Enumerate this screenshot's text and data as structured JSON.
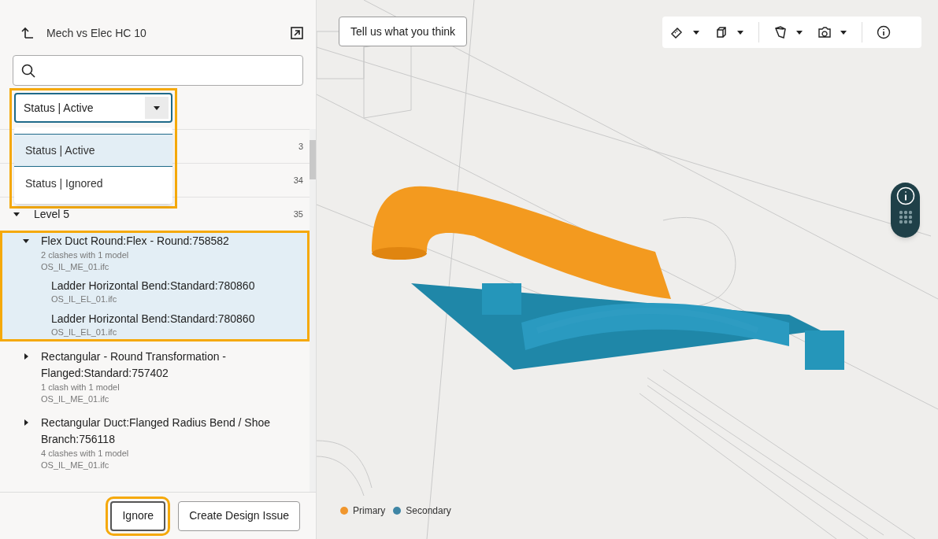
{
  "header": {
    "title": "Mech vs Elec HC 10"
  },
  "filter": {
    "value": "Status | Active",
    "expanded": true,
    "options": [
      {
        "label": "Status | Active",
        "selected": true
      },
      {
        "label": "Status | Ignored",
        "selected": false
      }
    ]
  },
  "groups": [
    {
      "count": "3"
    },
    {
      "count": "34"
    },
    {
      "label": "Level 5",
      "count": "35",
      "expanded": true,
      "items": [
        {
          "title": "Flex Duct Round:Flex - Round:758582",
          "subtitle": "2 clashes with 1 model",
          "file": "OS_IL_ME_01.ifc",
          "expanded": true,
          "selected": true,
          "children": [
            {
              "title": "Ladder Horizontal Bend:Standard:780860",
              "file": "OS_IL_EL_01.ifc"
            },
            {
              "title": "Ladder Horizontal Bend:Standard:780860",
              "file": "OS_IL_EL_01.ifc"
            }
          ]
        },
        {
          "title": "Rectangular - Round Transformation - Flanged:Standard:757402",
          "subtitle": "1 clash with 1 model",
          "file": "OS_IL_ME_01.ifc",
          "expanded": false,
          "selected": false
        },
        {
          "title": "Rectangular Duct:Flanged Radius Bend / Shoe Branch:756118",
          "subtitle": "4 clashes with 1 model",
          "file": "OS_IL_ME_01.ifc",
          "expanded": false,
          "selected": false
        }
      ]
    }
  ],
  "buttons": [
    {
      "label": "Ignore",
      "highlighted": true
    },
    {
      "label": "Create Design Issue",
      "highlighted": false
    }
  ],
  "viewer": {
    "feedback_button": "Tell us what you think",
    "legend": [
      {
        "label": "Primary",
        "color": "#f0962d"
      },
      {
        "label": "Secondary",
        "color": "#3f86a5"
      }
    ]
  }
}
